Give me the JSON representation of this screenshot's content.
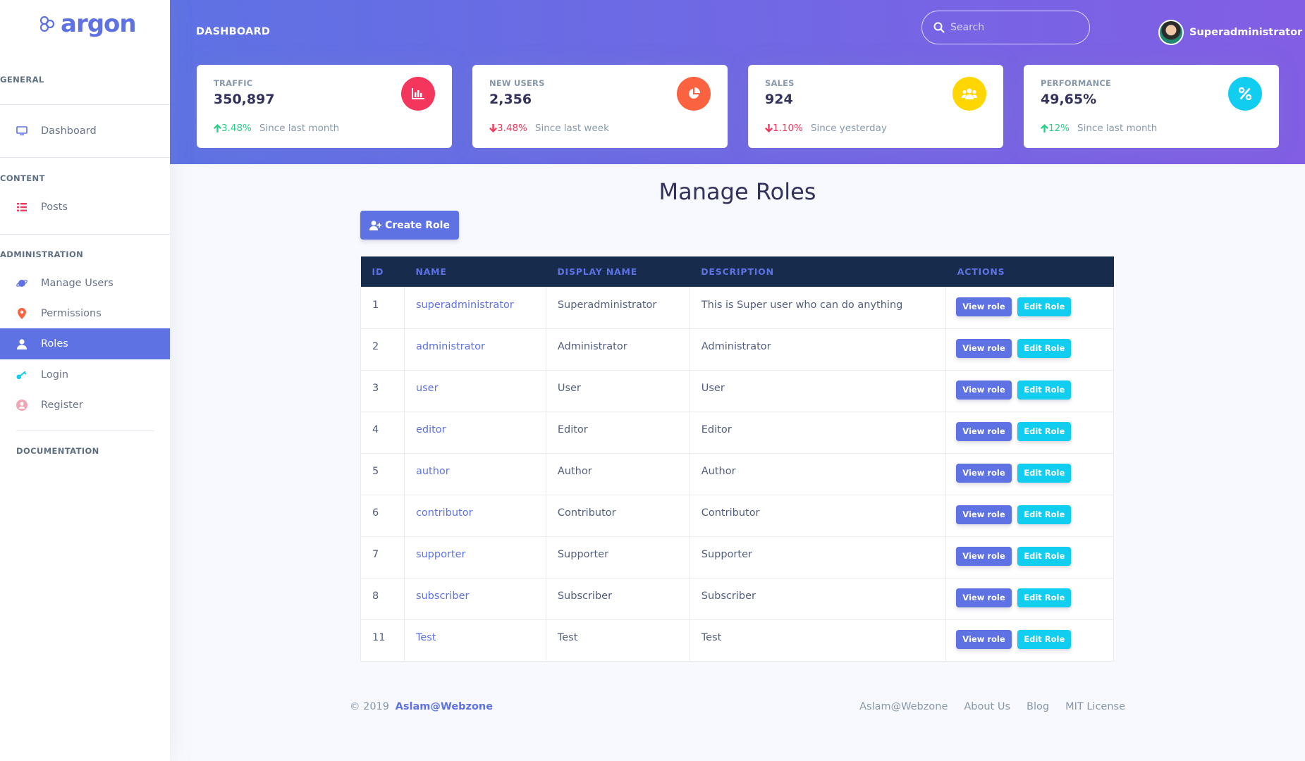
{
  "brand": {
    "name": "argon"
  },
  "sidebar": {
    "headings": {
      "general": "GENERAL",
      "content": "CONTENT",
      "administration": "ADMINISTRATION",
      "documentation": "DOCUMENTATION"
    },
    "items": {
      "dashboard": {
        "label": "Dashboard",
        "icon": "monitor-icon"
      },
      "posts": {
        "label": "Posts",
        "icon": "list-icon"
      },
      "manage_users": {
        "label": "Manage Users",
        "icon": "planet-icon"
      },
      "permissions": {
        "label": "Permissions",
        "icon": "pin-icon"
      },
      "roles": {
        "label": "Roles",
        "icon": "user-icon",
        "active": true
      },
      "login": {
        "label": "Login",
        "icon": "key-icon"
      },
      "register": {
        "label": "Register",
        "icon": "circle-user-icon"
      }
    }
  },
  "header": {
    "title": "DASHBOARD",
    "search_placeholder": "Search",
    "user_name": "Superadministrator"
  },
  "cards": [
    {
      "label": "TRAFFIC",
      "value": "350,897",
      "pct": "3.48%",
      "trend": "up",
      "since": "Since last month",
      "icon": "bar-chart-icon",
      "color": "#f5365c"
    },
    {
      "label": "NEW USERS",
      "value": "2,356",
      "pct": "3.48%",
      "trend": "down",
      "since": "Since last week",
      "icon": "pie-chart-icon",
      "color": "#fb6340"
    },
    {
      "label": "SALES",
      "value": "924",
      "pct": "1.10%",
      "trend": "down",
      "since": "Since yesterday",
      "icon": "users-icon",
      "color": "#ffd600"
    },
    {
      "label": "PERFORMANCE",
      "value": "49,65%",
      "pct": "12%",
      "trend": "up",
      "since": "Since last month",
      "icon": "percent-icon",
      "color": "#11cdef"
    }
  ],
  "main": {
    "title": "Manage Roles",
    "create_button": "Create Role",
    "columns": [
      "ID",
      "NAME",
      "DISPLAY NAME",
      "DESCRIPTION",
      "ACTIONS"
    ],
    "view_label": "View role",
    "edit_label": "Edit Role",
    "rows": [
      {
        "id": "1",
        "name": "superadministrator",
        "display": "Superadministrator",
        "description": "This is Super user who can do anything"
      },
      {
        "id": "2",
        "name": "administrator",
        "display": "Administrator",
        "description": "Administrator"
      },
      {
        "id": "3",
        "name": "user",
        "display": "User",
        "description": "User"
      },
      {
        "id": "4",
        "name": "editor",
        "display": "Editor",
        "description": "Editor"
      },
      {
        "id": "5",
        "name": "author",
        "display": "Author",
        "description": "Author"
      },
      {
        "id": "6",
        "name": "contributor",
        "display": "Contributor",
        "description": "Contributor"
      },
      {
        "id": "7",
        "name": "supporter",
        "display": "Supporter",
        "description": "Supporter"
      },
      {
        "id": "8",
        "name": "subscriber",
        "display": "Subscriber",
        "description": "Subscriber"
      },
      {
        "id": "11",
        "name": "Test",
        "display": "Test",
        "description": "Test"
      }
    ]
  },
  "footer": {
    "copyright": "© 2019",
    "brand_link": "Aslam@Webzone",
    "links": [
      "Aslam@Webzone",
      "About Us",
      "Blog",
      "MIT License"
    ]
  },
  "colors": {
    "primary": "#5e72e4",
    "info": "#11cdef",
    "success": "#2dce89",
    "danger": "#f5365c",
    "dark": "#172b4d"
  }
}
